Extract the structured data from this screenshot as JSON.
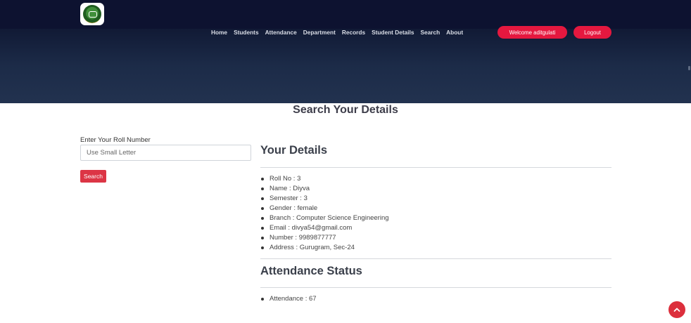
{
  "nav": {
    "links": [
      "Home",
      "Students",
      "Attendance",
      "Department",
      "Records",
      "Student Details",
      "Search",
      "About"
    ],
    "welcome": "Welcome aditgulati",
    "logout": "Logout"
  },
  "page": {
    "title": "Search Your Details"
  },
  "search": {
    "label": "Enter Your Roll Number",
    "placeholder": "Use Small Letter",
    "button": "Search"
  },
  "details": {
    "heading": "Your Details",
    "items": [
      "Roll No : 3",
      "Name : Diyva",
      "Semester : 3",
      "Gender : female",
      "Branch : Computer Science Engineering",
      "Email : divya54@gmail.com",
      "Number : 9989877777",
      "Address : Gurugram, Sec-24"
    ]
  },
  "attendance": {
    "heading": "Attendance Status",
    "items": [
      "Attendance : 67"
    ]
  },
  "icons": {
    "logo": "college-logo-icon",
    "scroll_top": "chevron-up-icon"
  },
  "colors": {
    "accent": "#dc3545",
    "topbar": "#0d1230",
    "hero": "#1c2b48"
  }
}
